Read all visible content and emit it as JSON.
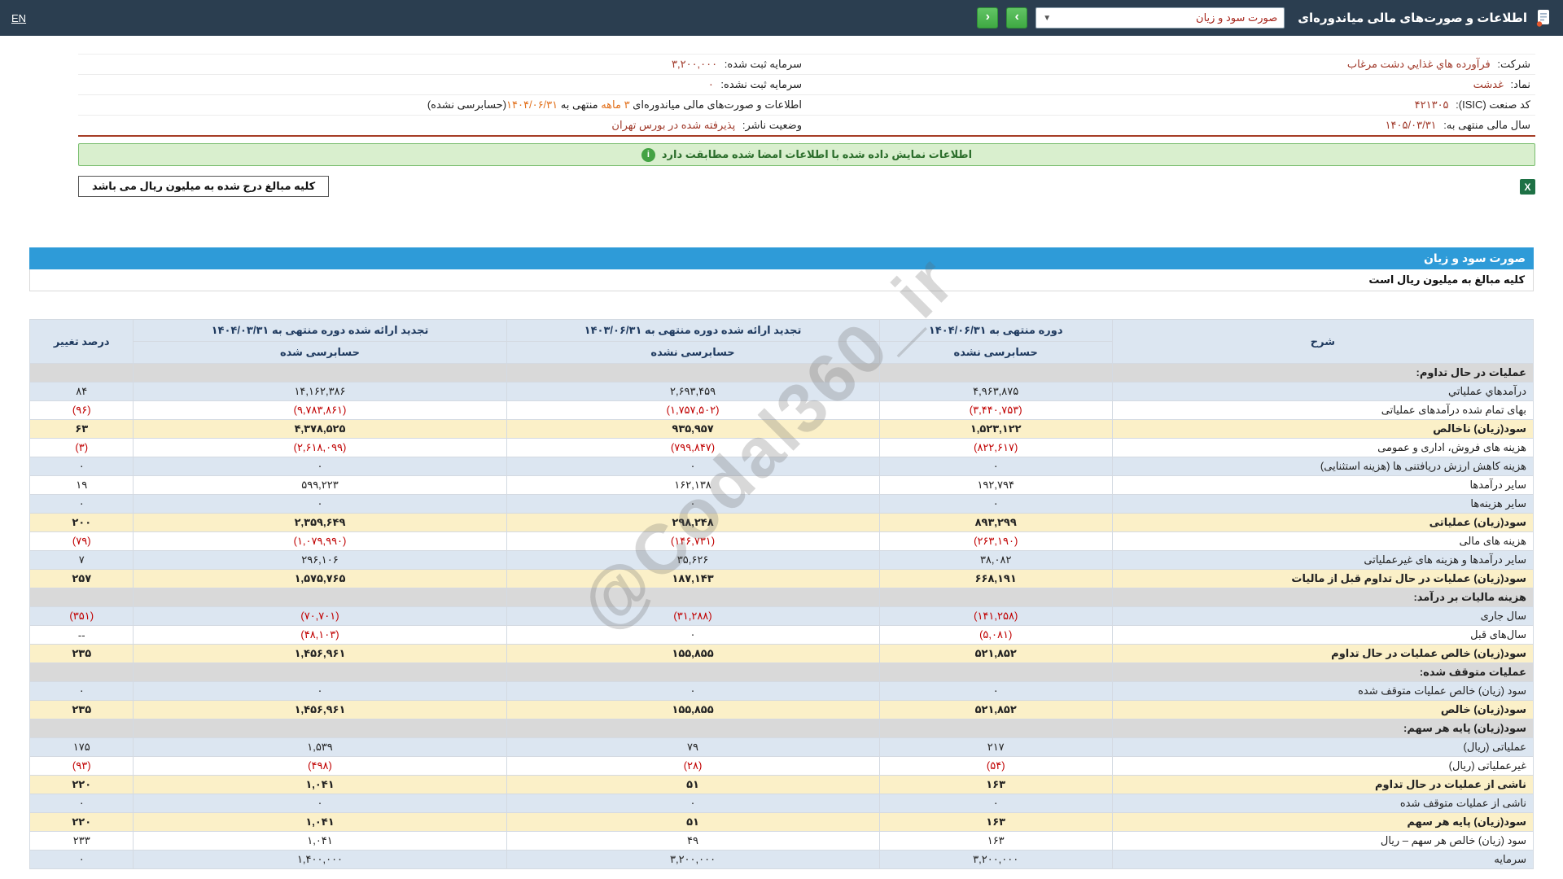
{
  "topbar": {
    "title": "اطلاعات و صورت‌های مالی میاندوره‌ای",
    "report_dropdown_value": "صورت سود و زیان",
    "next_button": "›",
    "prev_button": "‹",
    "en_link": "EN"
  },
  "info": {
    "rows": [
      {
        "right_label": "شرکت:",
        "right_value": "فرآورده هاي غذايي دشت مرغاب",
        "left_label": "سرمایه ثبت شده:",
        "left_value": "۳,۲۰۰,۰۰۰"
      },
      {
        "right_label": "نماد:",
        "right_value": "غدشت",
        "left_label": "سرمایه ثبت نشده:",
        "left_value": "۰"
      },
      {
        "right_label": "کد صنعت (ISIC):",
        "right_value": "۴۲۱۳۰۵"
      },
      {
        "right_label": "سال مالی منتهی به:",
        "right_value": "۱۴۰۵/۰۳/۳۱",
        "left_label": "وضعیت ناشر:",
        "left_value": "پذیرفته شده در بورس تهران"
      }
    ],
    "period_note": {
      "s1": "اطلاعات و صورت‌های مالی میاندوره‌ای ",
      "s2": "۳ ماهه",
      "s3": " منتهی به ",
      "s4": "۱۴۰۴/۰۶/۳۱",
      "s5": "(حسابرسی نشده)"
    }
  },
  "banner": {
    "text": "اطلاعات نمایش داده شده با اطلاعات امضا شده مطابقت دارد"
  },
  "units_note_top": "کلیه مبالغ درج شده به میلیون ریال می باشد",
  "statement": {
    "title": "صورت سود و زیان",
    "units_note": "کلیه مبالغ به میلیون ریال است",
    "header": {
      "desc": "شرح",
      "periods": [
        {
          "title": "دوره منتهی به ۱۴۰۴/۰۶/۳۱",
          "sub": "حسابرسی نشده"
        },
        {
          "title": "تجدید ارائه شده دوره منتهی به ۱۴۰۳/۰۶/۳۱",
          "sub": "حسابرسی نشده"
        },
        {
          "title": "تجدید ارائه شده دوره منتهی به ۱۴۰۴/۰۳/۳۱",
          "sub": "حسابرسی شده"
        }
      ],
      "change": "درصد تغییر"
    },
    "rows": [
      {
        "label": "عملیات در حال تداوم:",
        "values": [
          "",
          "",
          "",
          ""
        ],
        "style": "section"
      },
      {
        "label": "درآمدهاي عملياتي",
        "values": [
          "۴,۹۶۳,۸۷۵",
          "۲,۶۹۳,۴۵۹",
          "۱۴,۱۶۲,۳۸۶",
          "۸۴"
        ],
        "style": "blue"
      },
      {
        "label": "بهای تمام شده درآمدهای عملیاتی",
        "values": [
          "(۳,۴۴۰,۷۵۳)",
          "(۱,۷۵۷,۵۰۲)",
          "(۹,۷۸۳,۸۶۱)",
          "(۹۶)"
        ],
        "style": "plain"
      },
      {
        "label": "سود(زیان) ناخالص",
        "values": [
          "۱,۵۲۳,۱۲۲",
          "۹۳۵,۹۵۷",
          "۴,۳۷۸,۵۲۵",
          "۶۳"
        ],
        "style": "gold"
      },
      {
        "label": "هزینه های فروش، اداری و عمومی",
        "values": [
          "(۸۲۲,۶۱۷)",
          "(۷۹۹,۸۴۷)",
          "(۲,۶۱۸,۰۹۹)",
          "(۳)"
        ],
        "style": "plain"
      },
      {
        "label": "هزینه کاهش ارزش دریافتنی ها (هزینه استثنایی)",
        "values": [
          "۰",
          "۰",
          "۰",
          "۰"
        ],
        "style": "blue"
      },
      {
        "label": "سایر درآمدها",
        "values": [
          "۱۹۲,۷۹۴",
          "۱۶۲,۱۳۸",
          "۵۹۹,۲۲۳",
          "۱۹"
        ],
        "style": "plain"
      },
      {
        "label": "سایر هزینه‌ها",
        "values": [
          "۰",
          "۰",
          "۰",
          "۰"
        ],
        "style": "blue"
      },
      {
        "label": "سود(زیان) عملیاتی",
        "values": [
          "۸۹۳,۲۹۹",
          "۲۹۸,۲۴۸",
          "۲,۳۵۹,۶۴۹",
          "۲۰۰"
        ],
        "style": "gold"
      },
      {
        "label": "هزینه های مالی",
        "values": [
          "(۲۶۳,۱۹۰)",
          "(۱۴۶,۷۳۱)",
          "(۱,۰۷۹,۹۹۰)",
          "(۷۹)"
        ],
        "style": "plain"
      },
      {
        "label": "سایر درآمدها و هزینه های غیرعملیاتی",
        "values": [
          "۳۸,۰۸۲",
          "۳۵,۶۲۶",
          "۲۹۶,۱۰۶",
          "۷"
        ],
        "style": "blue"
      },
      {
        "label": "سود(زیان) عملیات در حال تداوم قبل از مالیات",
        "values": [
          "۶۶۸,۱۹۱",
          "۱۸۷,۱۴۳",
          "۱,۵۷۵,۷۶۵",
          "۲۵۷"
        ],
        "style": "gold"
      },
      {
        "label": "هزینه مالیات بر درآمد:",
        "values": [
          "",
          "",
          "",
          ""
        ],
        "style": "section"
      },
      {
        "label": "سال جاری",
        "values": [
          "(۱۴۱,۲۵۸)",
          "(۳۱,۲۸۸)",
          "(۷۰,۷۰۱)",
          "(۳۵۱)"
        ],
        "style": "blue"
      },
      {
        "label": "سال‌های قبل",
        "values": [
          "(۵,۰۸۱)",
          "۰",
          "(۴۸,۱۰۳)",
          "--"
        ],
        "style": "plain"
      },
      {
        "label": "سود(زیان) خالص عملیات در حال تداوم",
        "values": [
          "۵۲۱,۸۵۲",
          "۱۵۵,۸۵۵",
          "۱,۴۵۶,۹۶۱",
          "۲۳۵"
        ],
        "style": "gold"
      },
      {
        "label": "عملیات متوقف شده:",
        "values": [
          "",
          "",
          "",
          ""
        ],
        "style": "section"
      },
      {
        "label": "سود (زیان) خالص عملیات متوقف شده",
        "values": [
          "۰",
          "۰",
          "۰",
          "۰"
        ],
        "style": "blue"
      },
      {
        "label": "سود(زیان) خالص",
        "values": [
          "۵۲۱,۸۵۲",
          "۱۵۵,۸۵۵",
          "۱,۴۵۶,۹۶۱",
          "۲۳۵"
        ],
        "style": "gold"
      },
      {
        "label": "سود(زیان) پایه هر سهم:",
        "values": [
          "",
          "",
          "",
          ""
        ],
        "style": "section"
      },
      {
        "label": "عملیاتی (ریال)",
        "values": [
          "۲۱۷",
          "۷۹",
          "۱,۵۳۹",
          "۱۷۵"
        ],
        "style": "blue"
      },
      {
        "label": "غیرعملیاتی (ریال)",
        "values": [
          "(۵۴)",
          "(۲۸)",
          "(۴۹۸)",
          "(۹۳)"
        ],
        "style": "plain"
      },
      {
        "label": "ناشی از عملیات در حال تداوم",
        "values": [
          "۱۶۳",
          "۵۱",
          "۱,۰۴۱",
          "۲۲۰"
        ],
        "style": "gold"
      },
      {
        "label": "ناشی از عملیات متوقف شده",
        "values": [
          "۰",
          "۰",
          "۰",
          "۰"
        ],
        "style": "blue"
      },
      {
        "label": "سود(زیان) پایه هر سهم",
        "values": [
          "۱۶۳",
          "۵۱",
          "۱,۰۴۱",
          "۲۲۰"
        ],
        "style": "gold"
      },
      {
        "label": "سود (زیان) خالص هر سهم – ریال",
        "values": [
          "۱۶۳",
          "۴۹",
          "۱,۰۴۱",
          "۲۳۳"
        ],
        "style": "plain"
      },
      {
        "label": "سرمایه",
        "values": [
          "۳,۲۰۰,۰۰۰",
          "۳,۲۰۰,۰۰۰",
          "۱,۴۰۰,۰۰۰",
          "۰"
        ],
        "style": "blue"
      }
    ]
  },
  "watermark": "@Codal360_ir",
  "colors": {
    "topbar_bg": "#2b3e50",
    "accent_blue": "#2e9bd8",
    "negative_red": "#c00000",
    "highlight_row": "#fbf0c8",
    "alt_row": "#dce6f1",
    "section_row": "#d9d9d9",
    "info_value": "#a0392a",
    "period_orange": "#e2711d",
    "banner_green": "#d9efce"
  }
}
